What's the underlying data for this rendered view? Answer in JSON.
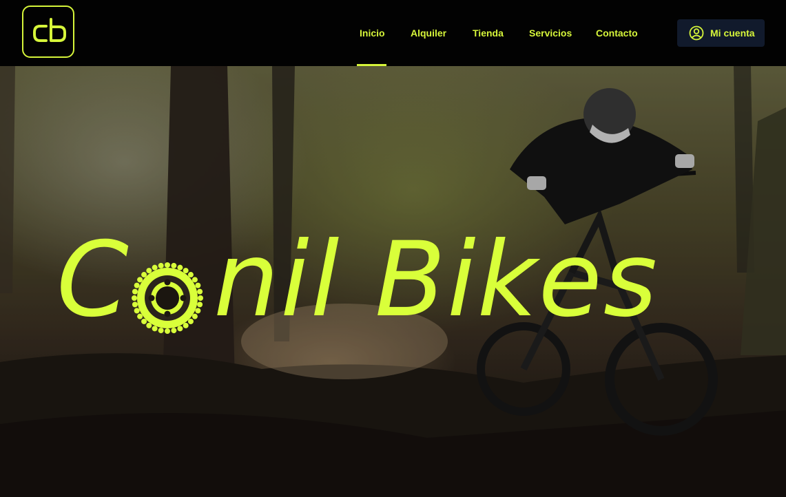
{
  "nav": {
    "items": [
      {
        "label": "Inicio",
        "active": true
      },
      {
        "label": "Alquiler",
        "active": false
      },
      {
        "label": "Tienda",
        "active": false
      },
      {
        "label": "Servicios",
        "active": false
      },
      {
        "label": "Contacto",
        "active": false
      }
    ]
  },
  "account": {
    "label": "Mi cuenta",
    "icon": "user-circle-icon"
  },
  "logo": {
    "text": "cb"
  },
  "hero": {
    "title_first": "C",
    "title_rest": "nil Bikes",
    "title_full": "Conil Bikes",
    "accent_color": "#d9ff3a",
    "background": "mountain-biker-forest-photo"
  }
}
